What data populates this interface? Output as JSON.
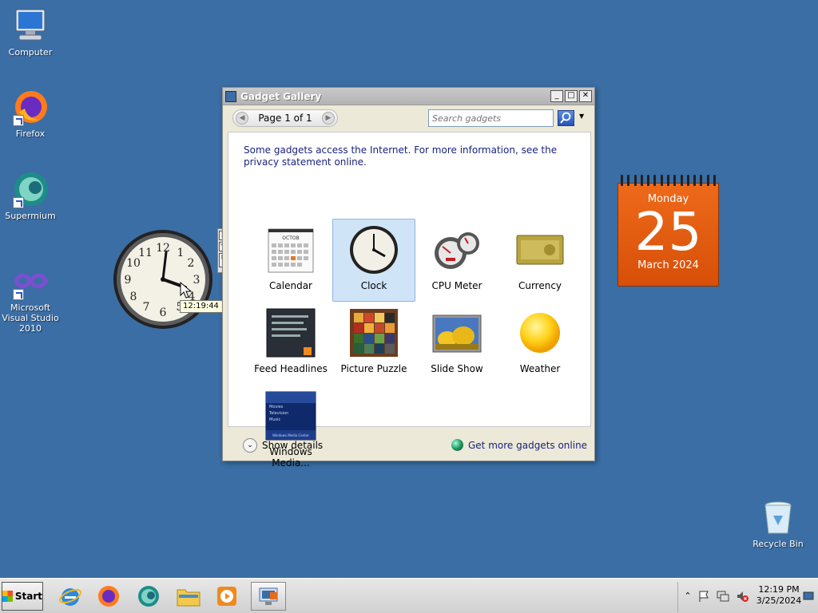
{
  "desktop": {
    "icons": [
      {
        "label": "Computer",
        "icon": "computer-icon"
      },
      {
        "label": "Firefox",
        "icon": "firefox-icon"
      },
      {
        "label": "Supermium",
        "icon": "supermium-icon"
      },
      {
        "label": "Microsoft Visual Studio 2010",
        "icon": "visual-studio-icon"
      },
      {
        "label": "Recycle Bin",
        "icon": "recycle-bin-icon"
      }
    ]
  },
  "window": {
    "title": "Gadget Gallery",
    "pager_label": "Page 1 of 1",
    "search_placeholder": "Search gadgets",
    "notice": "Some gadgets access the Internet.  For more information, see the privacy statement online.",
    "gadgets": [
      {
        "label": "Calendar",
        "icon": "calendar-icon",
        "selected": false
      },
      {
        "label": "Clock",
        "icon": "clock-icon",
        "selected": true
      },
      {
        "label": "CPU Meter",
        "icon": "cpu-meter-icon",
        "selected": false
      },
      {
        "label": "Currency",
        "icon": "currency-icon",
        "selected": false
      },
      {
        "label": "Feed Headlines",
        "icon": "feed-headlines-icon",
        "selected": false
      },
      {
        "label": "Picture Puzzle",
        "icon": "picture-puzzle-icon",
        "selected": false
      },
      {
        "label": "Slide Show",
        "icon": "slide-show-icon",
        "selected": false
      },
      {
        "label": "Weather",
        "icon": "weather-icon",
        "selected": false
      },
      {
        "label": "Windows Media...",
        "icon": "windows-media-center-icon",
        "selected": false
      }
    ],
    "calendar_thumb_month": "OCTOB",
    "media_center_thumb_items": [
      "Movies",
      "Television",
      "Music"
    ],
    "media_center_thumb_caption": "Windows Media Center",
    "show_details_label": "Show details",
    "more_gadgets_label": "Get more gadgets online"
  },
  "clock_gadget": {
    "tooltip": "12:19:44 PM",
    "numerals": [
      "12",
      "1",
      "2",
      "3",
      "4",
      "5",
      "6",
      "7",
      "8",
      "9",
      "10",
      "11"
    ]
  },
  "calendar_gadget": {
    "weekday": "Monday",
    "day": "25",
    "month_year": "March 2024"
  },
  "taskbar": {
    "start_label": "Start",
    "apps": [
      "internet-explorer-icon",
      "firefox-icon",
      "supermium-icon",
      "file-explorer-icon",
      "media-player-icon",
      "gadget-gallery-icon"
    ],
    "tray_time": "12:19 PM",
    "tray_date": "3/25/2024"
  }
}
